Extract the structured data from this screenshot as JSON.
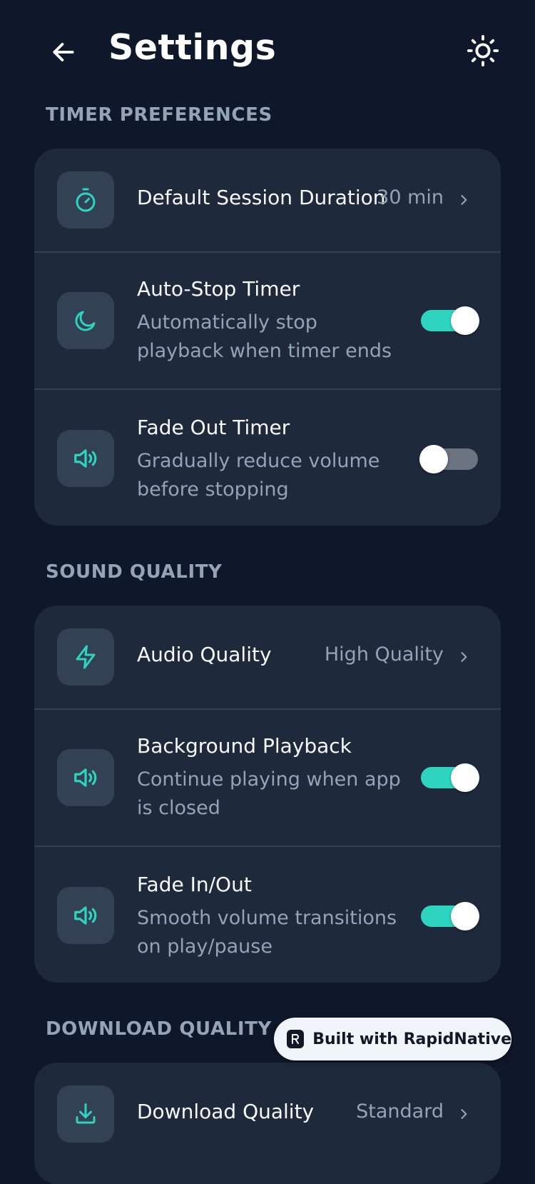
{
  "header": {
    "title": "Settings"
  },
  "sections": [
    {
      "title": "TIMER PREFERENCES",
      "items": [
        {
          "title": "Default Session Duration",
          "value": "30 min",
          "icon": "timer-icon"
        },
        {
          "title": "Auto-Stop Timer",
          "subtitle": "Automatically stop playback when timer ends",
          "toggle": true,
          "icon": "moon-icon"
        },
        {
          "title": "Fade Out Timer",
          "subtitle": "Gradually reduce volume before stopping",
          "toggle": false,
          "icon": "volume-icon"
        }
      ]
    },
    {
      "title": "SOUND QUALITY",
      "items": [
        {
          "title": "Audio Quality",
          "value": "High Quality",
          "icon": "lightning-icon"
        },
        {
          "title": "Background Playback",
          "subtitle": "Continue playing when app is closed",
          "toggle": true,
          "icon": "volume-icon"
        },
        {
          "title": "Fade In/Out",
          "subtitle": "Smooth volume transitions on play/pause",
          "toggle": true,
          "icon": "volume-icon"
        }
      ]
    },
    {
      "title": "DOWNLOAD QUALITY",
      "items": [
        {
          "title": "Download Quality",
          "value": "Standard",
          "icon": "download-icon"
        }
      ]
    }
  ],
  "badge": {
    "text": "Built with RapidNative"
  },
  "colors": {
    "background": "#0f172a",
    "card": "#1e293b",
    "accent": "#2dd4bf",
    "muted": "#94a3b8"
  }
}
